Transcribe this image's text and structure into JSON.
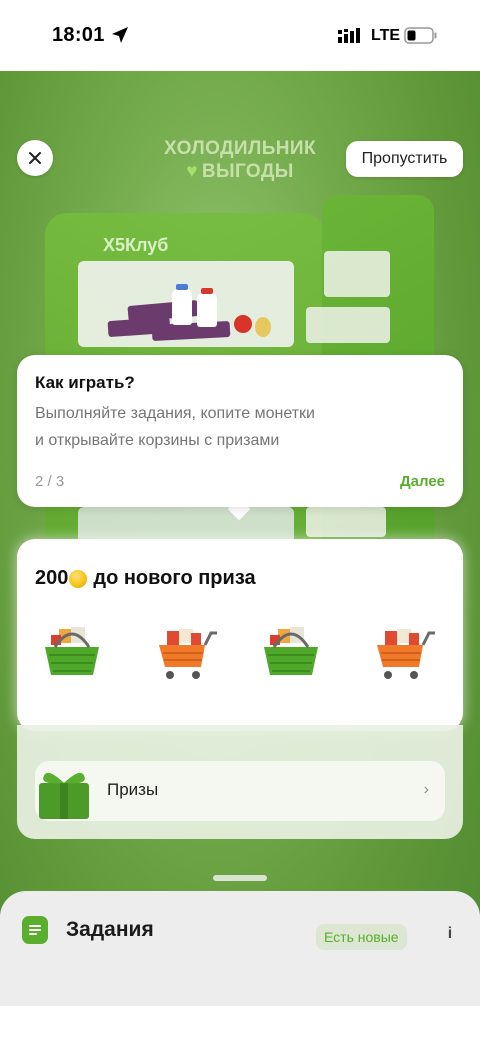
{
  "status_bar": {
    "time": "18:01",
    "network": "LTE"
  },
  "game": {
    "logo_line1": "ХОЛОДИЛЬНИК",
    "logo_line2": "ВЫГОДЫ",
    "fridge_brand": "Х5Клуб",
    "skip_label": "Пропустить"
  },
  "tooltip": {
    "title": "Как играть?",
    "text_line1": "Выполняйте задания, копите монетки",
    "text_line2": "и открывайте корзины с призами",
    "step": "2 / 3",
    "next_label": "Далее"
  },
  "progress": {
    "coins": "200",
    "title_suffix": "до нового приза",
    "steps": [
      "1",
      "2",
      "3",
      "4"
    ],
    "fill_fraction": 0.08
  },
  "prizes": {
    "label": "Призы"
  },
  "tasks": {
    "title": "Задания",
    "badge": "Есть новые",
    "info": "i"
  },
  "colors": {
    "accent_green": "#58ad2c",
    "basket_green": "#4fa82a",
    "cart_orange": "#f07a2a"
  }
}
